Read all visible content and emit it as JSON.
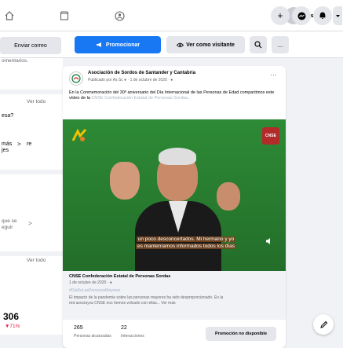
{
  "nav": {
    "icons": [
      "home-icon",
      "store-icon",
      "groups-icon",
      "profile-avatar",
      "plus-icon",
      "messenger-icon",
      "notifications-icon",
      "dropdown-icon"
    ],
    "profile_label": "As"
  },
  "actions": {
    "email_label": "Enviar correo",
    "promote_label": "Promocionar",
    "visitor_label": "Ver como visitante",
    "more_label": "..."
  },
  "left": {
    "frag1": "omentarios.",
    "frag2": "Ver todo",
    "frag3": "esa?",
    "frag4": "más",
    "frag5": "jes",
    "frag6": "que se",
    "frag7": "eguir",
    "frag8": "Ver todo",
    "big_number": "306",
    "change": "▼71%"
  },
  "post": {
    "author": "Asociación de Sordos de Santander y Cantabria",
    "meta": "Publicado por As Sc ● · 1 de octubre de 2020 · ●",
    "body": "En la Conmemoración del 30º aniversario del Día Internacional de las Personas de Edad compartimos este vídeo de la ",
    "body_link": "CNSE Confederación Estatal de Personas Sordas",
    "body_end": ".",
    "video_caption_line1": "un poco desconcertados. Mi hermano y yo",
    "video_caption_line2": "es manteníamos informados todos los días",
    "card_title": "CNSE Confederación Estatal de Personas Sordas",
    "card_meta": "1 de octubre de 2020 · ●",
    "card_tag": "#DíaDeLasPersonasMayores",
    "card_body": "El impacto de la pandemia sobre las personas mayores ha sido desproporcionado. En la red asociayva CNSE nos hemos volcado con ellas... Ver más"
  },
  "stats": {
    "reach_value": "265",
    "reach_label": "Personas alcanzadas",
    "interactions_value": "22",
    "interactions_label": "Interacciones",
    "promo_label": "Promoción no disponible"
  },
  "colors": {
    "accent": "#1877f2",
    "video_green": "#2f7d2e"
  }
}
